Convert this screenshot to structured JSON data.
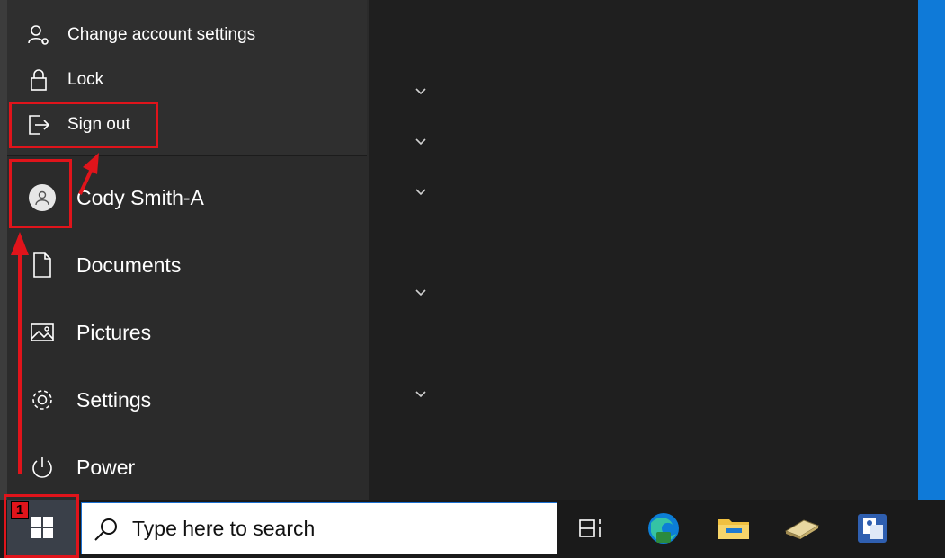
{
  "flyout": {
    "items": [
      {
        "label": "Change account settings",
        "icon": "account-settings-icon"
      },
      {
        "label": "Lock",
        "icon": "lock-icon"
      },
      {
        "label": "Sign out",
        "icon": "sign-out-icon"
      }
    ]
  },
  "start_menu": {
    "user": {
      "name": "Cody Smith-A",
      "icon": "user-avatar-icon"
    },
    "items": [
      {
        "label": "Documents",
        "icon": "document-icon"
      },
      {
        "label": "Pictures",
        "icon": "pictures-icon"
      },
      {
        "label": "Settings",
        "icon": "gear-icon"
      },
      {
        "label": "Power",
        "icon": "power-icon"
      }
    ]
  },
  "taskbar": {
    "search_placeholder": "Type here to search",
    "pinned": [
      "task-view-icon",
      "edge-icon",
      "file-explorer-icon",
      "scanner-icon",
      "app-icon"
    ]
  },
  "annotations": {
    "step_badge": "1",
    "highlight_color": "#e0141b"
  },
  "colors": {
    "desktop_accent": "#0f7ad8",
    "search_border": "#1a6fd0"
  }
}
